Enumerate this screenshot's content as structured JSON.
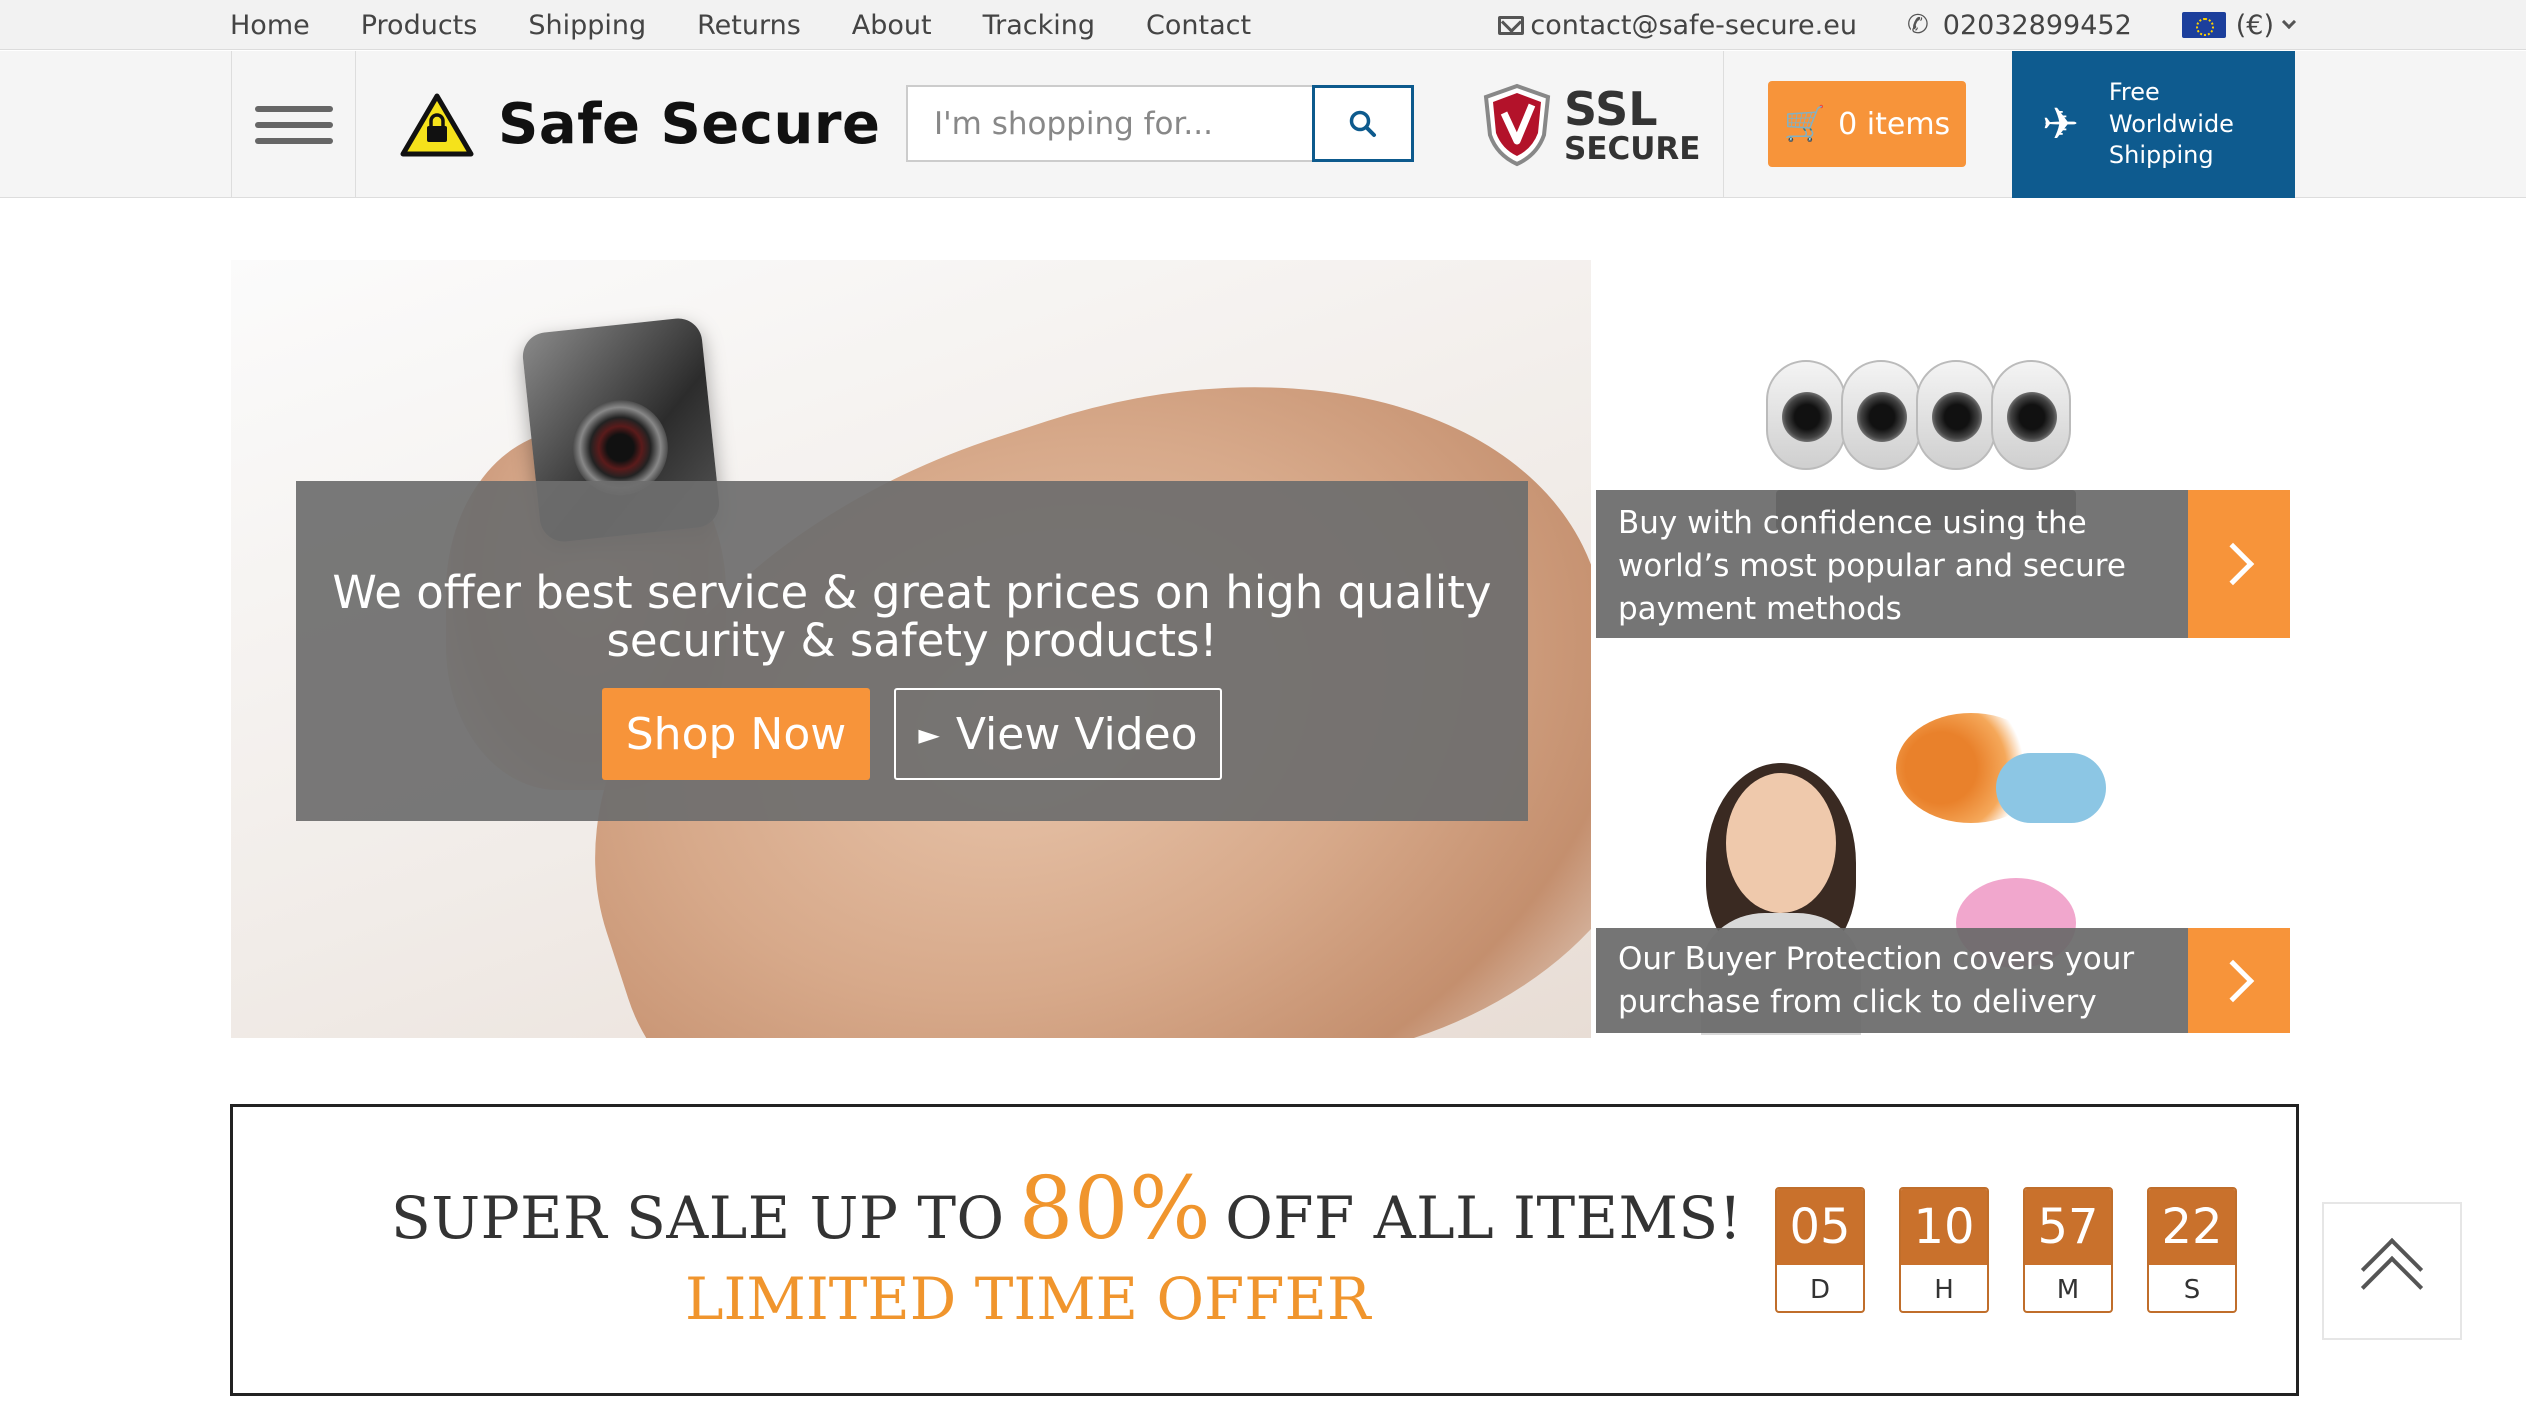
{
  "topnav": {
    "links": [
      "Home",
      "Products",
      "Shipping",
      "Returns",
      "About",
      "Tracking",
      "Contact"
    ],
    "email": "contact@safe-secure.eu",
    "phone": "02032899452",
    "currency": "(€)"
  },
  "header": {
    "logo_text": "Safe Secure",
    "search_placeholder": "I'm shopping for...",
    "ssl_big": "SSL",
    "ssl_small": "SECURE",
    "cart_label": "0 items",
    "shipping_lines": [
      "Free",
      "Worldwide",
      "Shipping"
    ]
  },
  "hero": {
    "message": "We offer best service & great prices on high quality security & safety products!",
    "shop_button": "Shop Now",
    "video_button": "View Video"
  },
  "side": [
    {
      "caption": "Buy with confidence using the world’s most popular and secure payment methods"
    },
    {
      "caption": "Our Buyer Protection covers your purchase from click to delivery"
    }
  ],
  "sale": {
    "prefix": "SUPER SALE UP TO",
    "percent": "80%",
    "suffix": "OFF ALL ITEMS!",
    "subline": "LIMITED TIME OFFER",
    "countdown": [
      {
        "value": "05",
        "label": "D"
      },
      {
        "value": "10",
        "label": "H"
      },
      {
        "value": "57",
        "label": "M"
      },
      {
        "value": "22",
        "label": "S"
      }
    ]
  },
  "colors": {
    "accent_orange": "#f7943a",
    "shipping_blue": "#0e5b8f",
    "countdown_brown": "#c9712c"
  },
  "icons": [
    "envelope-icon",
    "phone-icon",
    "eu-flag-icon",
    "chevron-down-icon",
    "hamburger-icon",
    "warning-lock-icon",
    "search-icon",
    "ssl-shield-icon",
    "cart-icon",
    "plane-icon",
    "chevron-right-icon",
    "back-to-top-icon"
  ]
}
